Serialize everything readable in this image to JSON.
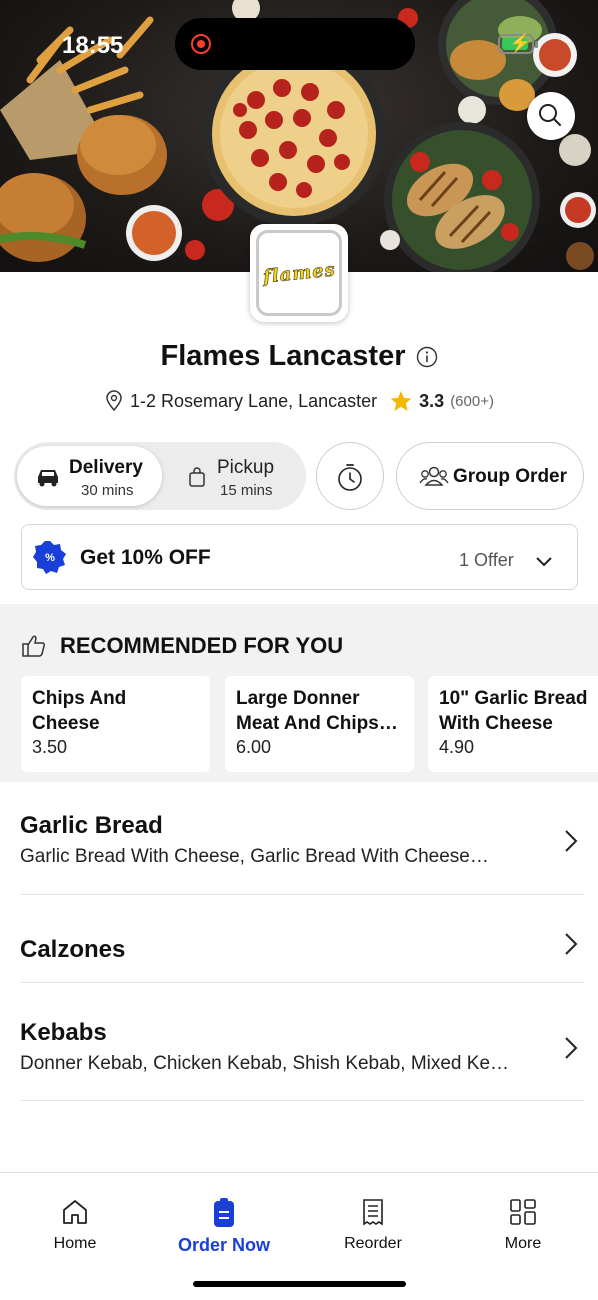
{
  "status_bar": {
    "time": "18:55"
  },
  "restaurant": {
    "logo_text": "flames",
    "name": "Flames Lancaster",
    "address": "1-2 Rosemary Lane, Lancaster",
    "rating": "3.3",
    "rating_count": "(600+)"
  },
  "order_mode": {
    "delivery": {
      "label": "Delivery",
      "time": "30 mins"
    },
    "pickup": {
      "label": "Pickup",
      "time": "15 mins"
    },
    "group_order_label": "Group Order"
  },
  "offer": {
    "title": "Get 10% OFF",
    "count": "1 Offer"
  },
  "recommended": {
    "title": "RECOMMENDED FOR YOU",
    "items": [
      {
        "name_line1": "Chips And",
        "name_line2": "Cheese",
        "price": "3.50"
      },
      {
        "name_line1": "Large Donner",
        "name_line2": "Meat And Chips…",
        "price": "6.00"
      },
      {
        "name_line1": "10\" Garlic Bread",
        "name_line2": "With Cheese",
        "price": "4.90"
      }
    ]
  },
  "categories": [
    {
      "title": "Garlic Bread",
      "desc": "Garlic Bread With Cheese, Garlic Bread With Cheese…"
    },
    {
      "title": "Calzones",
      "desc": ""
    },
    {
      "title": "Kebabs",
      "desc": "Donner Kebab, Chicken Kebab, Shish Kebab, Mixed Ke…"
    }
  ],
  "tabs": [
    {
      "label": "Home",
      "icon": "home-icon"
    },
    {
      "label": "Order Now",
      "icon": "order-icon"
    },
    {
      "label": "Reorder",
      "icon": "receipt-icon"
    },
    {
      "label": "More",
      "icon": "grid-icon"
    }
  ],
  "colors": {
    "accent": "#1a3fd8",
    "star": "#f5b800",
    "offer_badge": "#1a3fd8"
  }
}
